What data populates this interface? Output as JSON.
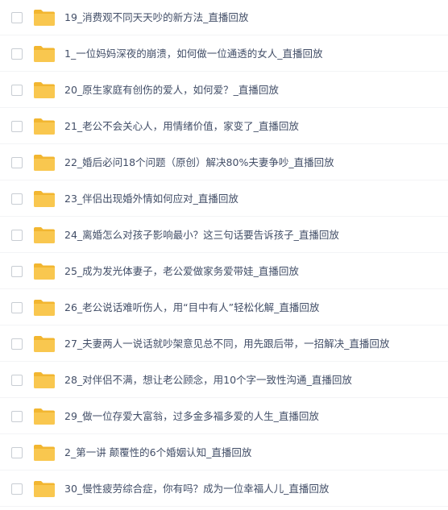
{
  "folder_icon": "folder-icon",
  "folder_color": "#f9c74f",
  "files": [
    {
      "name": "19_消费观不同天天吵的新方法_直播回放"
    },
    {
      "name": "1_一位妈妈深夜的崩溃，如何做一位通透的女人_直播回放"
    },
    {
      "name": "20_原生家庭有创伤的爱人，如何爱？_直播回放"
    },
    {
      "name": "21_老公不会关心人，用情绪价值，家变了_直播回放"
    },
    {
      "name": "22_婚后必问18个问题（原创）解决80%夫妻争吵_直播回放"
    },
    {
      "name": "23_伴侣出现婚外情如何应对_直播回放"
    },
    {
      "name": "24_离婚怎么对孩子影响最小？这三句话要告诉孩子_直播回放"
    },
    {
      "name": "25_成为发光体妻子，老公爱做家务爱带娃_直播回放"
    },
    {
      "name": "26_老公说话难听伤人，用“目中有人”轻松化解_直播回放"
    },
    {
      "name": "27_夫妻两人一说话就吵架意见总不同，用先跟后带，一招解决_直播回放"
    },
    {
      "name": "28_对伴侣不满，想让老公顾念，用10个字一致性沟通_直播回放"
    },
    {
      "name": "29_做一位存爱大富翁，过多金多福多爱的人生_直播回放"
    },
    {
      "name": "2_第一讲 颠覆性的6个婚姻认知_直播回放"
    },
    {
      "name": "30_慢性疲劳综合症，你有吗？成为一位幸福人儿_直播回放"
    }
  ]
}
